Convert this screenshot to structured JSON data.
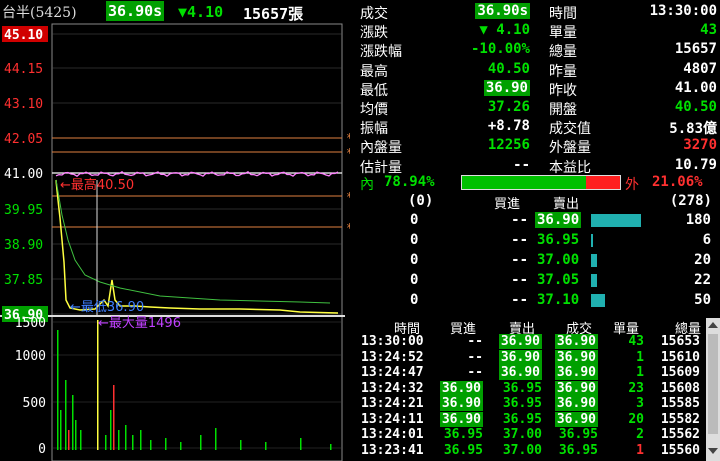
{
  "header": {
    "name": "台半(5425)",
    "price": "36.90s",
    "change": "▼4.10",
    "volume": "15657張"
  },
  "price_axis": [
    "45.10",
    "44.15",
    "43.10",
    "42.05",
    "41.00",
    "39.95",
    "38.90",
    "37.85",
    "36.90"
  ],
  "volume_axis": [
    "1500",
    "1000",
    "500",
    "0"
  ],
  "annotations": {
    "high": "←最高40.50",
    "low": "←最低36.90",
    "max_vol": "←最大量1496",
    "stars": [
      "*",
      "*",
      "*",
      "*"
    ]
  },
  "quote": {
    "left": [
      {
        "label": "成交",
        "value": "36.90s",
        "style": "hl"
      },
      {
        "label": "漲跌",
        "value": "▼ 4.10",
        "style": "green"
      },
      {
        "label": "漲跌幅",
        "value": "-10.00%",
        "style": "green"
      },
      {
        "label": "最高",
        "value": "40.50",
        "style": "green"
      },
      {
        "label": "最低",
        "value": "36.90",
        "style": "hl"
      },
      {
        "label": "均價",
        "value": "37.26",
        "style": "green"
      },
      {
        "label": "振幅",
        "value": "+8.78",
        "style": "white"
      },
      {
        "label": "內盤量",
        "value": "12256",
        "style": "green"
      },
      {
        "label": "估計量",
        "value": "--",
        "style": "white"
      }
    ],
    "right": [
      {
        "label": "時間",
        "value": "13:30:00",
        "style": "white"
      },
      {
        "label": "單量",
        "value": "43",
        "style": "green"
      },
      {
        "label": "總量",
        "value": "15657",
        "style": "white"
      },
      {
        "label": "昨量",
        "value": "4807",
        "style": "white"
      },
      {
        "label": "昨收",
        "value": "41.00",
        "style": "white"
      },
      {
        "label": "開盤",
        "value": "40.50",
        "style": "green"
      },
      {
        "label": "成交值",
        "value": "5.83億",
        "style": "white"
      },
      {
        "label": "外盤量",
        "value": "3270",
        "style": "red"
      },
      {
        "label": "本益比",
        "value": "10.79",
        "style": "white"
      }
    ]
  },
  "ratio": {
    "in_label": "內",
    "in_pct": "78.94%",
    "out_label": "外",
    "out_pct": "21.06%",
    "in_fraction": 0.7894
  },
  "orderbook": {
    "bid_total": "(0)",
    "bid_label": "買進",
    "ask_label": "賣出",
    "ask_total": "(278)",
    "rows": [
      {
        "bid_qty": "0",
        "bid": "--",
        "ask": "36.90",
        "ask_qty": "180",
        "bar": 180
      },
      {
        "bid_qty": "0",
        "bid": "--",
        "ask": "36.95",
        "ask_qty": "6",
        "bar": 6
      },
      {
        "bid_qty": "0",
        "bid": "--",
        "ask": "37.00",
        "ask_qty": "20",
        "bar": 20
      },
      {
        "bid_qty": "0",
        "bid": "--",
        "ask": "37.05",
        "ask_qty": "22",
        "bar": 22
      },
      {
        "bid_qty": "0",
        "bid": "--",
        "ask": "37.10",
        "ask_qty": "50",
        "bar": 50
      }
    ]
  },
  "trades": {
    "headers": [
      "時間",
      "買進",
      "賣出",
      "成交",
      "單量",
      "總量"
    ],
    "rows": [
      {
        "time": "13:30:00",
        "bid": "--",
        "ask": "36.90",
        "price": "36.90",
        "qty": "43",
        "total": "15653",
        "bidHl": false,
        "askHl": true,
        "priceHl": true,
        "qtyRed": false
      },
      {
        "time": "13:24:52",
        "bid": "--",
        "ask": "36.90",
        "price": "36.90",
        "qty": "1",
        "total": "15610",
        "bidHl": false,
        "askHl": true,
        "priceHl": true,
        "qtyRed": false
      },
      {
        "time": "13:24:47",
        "bid": "--",
        "ask": "36.90",
        "price": "36.90",
        "qty": "1",
        "total": "15609",
        "bidHl": false,
        "askHl": true,
        "priceHl": true,
        "qtyRed": false
      },
      {
        "time": "13:24:32",
        "bid": "36.90",
        "ask": "36.95",
        "price": "36.90",
        "qty": "23",
        "total": "15608",
        "bidHl": true,
        "askHl": false,
        "priceHl": true,
        "qtyRed": false
      },
      {
        "time": "13:24:21",
        "bid": "36.90",
        "ask": "36.95",
        "price": "36.90",
        "qty": "3",
        "total": "15585",
        "bidHl": true,
        "askHl": false,
        "priceHl": true,
        "qtyRed": false
      },
      {
        "time": "13:24:11",
        "bid": "36.90",
        "ask": "36.95",
        "price": "36.90",
        "qty": "20",
        "total": "15582",
        "bidHl": true,
        "askHl": false,
        "priceHl": true,
        "qtyRed": false
      },
      {
        "time": "13:24:01",
        "bid": "36.95",
        "ask": "37.00",
        "price": "36.95",
        "qty": "2",
        "total": "15562",
        "bidHl": false,
        "askHl": false,
        "priceHl": false,
        "qtyRed": false
      },
      {
        "time": "13:23:41",
        "bid": "36.95",
        "ask": "37.00",
        "price": "36.95",
        "qty": "1",
        "total": "15560",
        "bidHl": false,
        "askHl": false,
        "priceHl": false,
        "qtyRed": true
      }
    ]
  },
  "colors": {
    "up": "#ff3030",
    "down": "#00e000",
    "highlight": "#00a000",
    "avgLine": "#ff80ff",
    "refLine": "#e08040"
  }
}
